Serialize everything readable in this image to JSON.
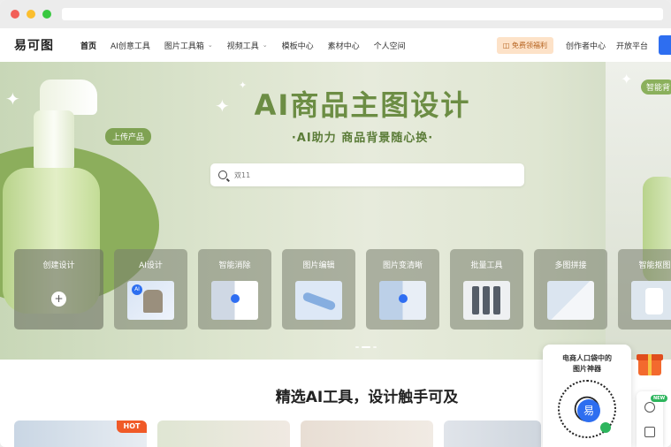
{
  "nav": {
    "logo": "易可图",
    "items": [
      {
        "label": "首页",
        "active": true,
        "dropdown": false
      },
      {
        "label": "AI创意工具",
        "active": false,
        "dropdown": false
      },
      {
        "label": "图片工具箱",
        "active": false,
        "dropdown": true
      },
      {
        "label": "视频工具",
        "active": false,
        "dropdown": true
      },
      {
        "label": "模板中心",
        "active": false,
        "dropdown": false
      },
      {
        "label": "素材中心",
        "active": false,
        "dropdown": false
      },
      {
        "label": "个人空间",
        "active": false,
        "dropdown": false
      }
    ],
    "benefit": "免费领福利",
    "creator": "创作者中心",
    "open_platform": "开放平台"
  },
  "hero": {
    "title": "AI商品主图设计",
    "subtitle": "·AI助力 商品背景随心换·",
    "upload_tag": "上传产品",
    "right_tag": "智能背",
    "search_placeholder": "双11"
  },
  "cards": [
    {
      "label": "创建设计"
    },
    {
      "label": "AI设计"
    },
    {
      "label": "智能消除"
    },
    {
      "label": "图片编辑"
    },
    {
      "label": "图片变清晰"
    },
    {
      "label": "批量工具"
    },
    {
      "label": "多图拼接"
    },
    {
      "label": "智能抠图"
    }
  ],
  "section": {
    "title": "精选AI工具，设计触手可及",
    "hot_badge": "HOT"
  },
  "widget": {
    "qr_line1": "电商人口袋中的",
    "qr_line2": "图片神器",
    "qr_center": "易",
    "new_badge": "NEW"
  },
  "colors": {
    "accent": "#2e6ef0",
    "hero_green": "#6c8d44",
    "hot": "#f05a28"
  }
}
